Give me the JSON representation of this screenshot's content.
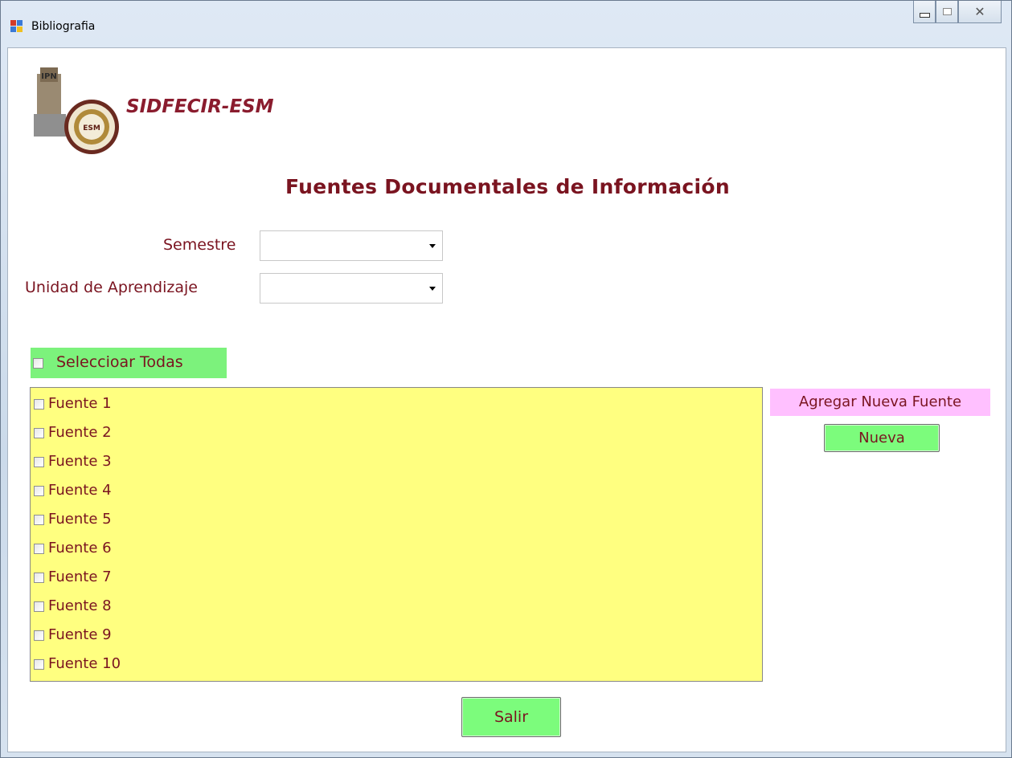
{
  "window": {
    "title": "Bibliografia",
    "icon": "app-form-icon",
    "controls": [
      "minimize-icon",
      "maximize-icon",
      "close-icon"
    ],
    "close_glyph": "✕"
  },
  "header": {
    "brand": "SIDFECIR-ESM",
    "heading": "Fuentes Documentales de Información",
    "logo_text_ipn": "IPN",
    "logo_text_esm": "ESM"
  },
  "form": {
    "semestre_label": "Semestre",
    "semestre_value": "",
    "unidad_label": "Unidad de Aprendizaje",
    "unidad_value": ""
  },
  "select_all": {
    "label": "Seleccioar Todas",
    "checked": false
  },
  "sources": [
    {
      "label": "Fuente 1",
      "checked": false
    },
    {
      "label": "Fuente 2",
      "checked": false
    },
    {
      "label": "Fuente 3",
      "checked": false
    },
    {
      "label": "Fuente 4",
      "checked": false
    },
    {
      "label": "Fuente 5",
      "checked": false
    },
    {
      "label": "Fuente 6",
      "checked": false
    },
    {
      "label": "Fuente 7",
      "checked": false
    },
    {
      "label": "Fuente 8",
      "checked": false
    },
    {
      "label": "Fuente 9",
      "checked": false
    },
    {
      "label": "Fuente 10",
      "checked": false
    }
  ],
  "add_source": {
    "label": "Agregar Nueva Fuente",
    "button": "Nueva"
  },
  "footer": {
    "exit_button": "Salir"
  },
  "colors": {
    "text": "#7a1420",
    "list_bg": "#ffff80",
    "button_bg": "#7cfc7c",
    "add_label_bg": "#ffc0ff",
    "select_all_bg": "#7cf27c"
  }
}
